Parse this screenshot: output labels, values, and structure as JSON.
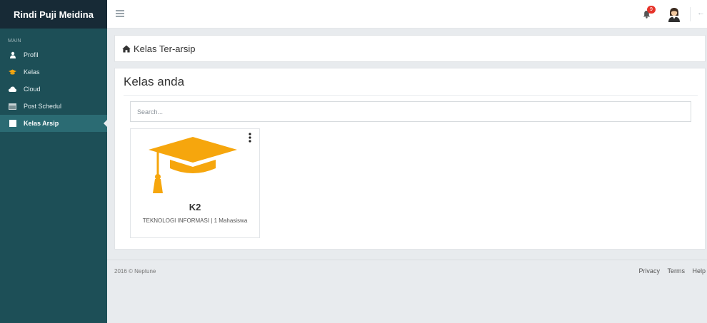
{
  "sidebar": {
    "brand": "Rindi Puji Meidina",
    "section_label": "MAIN",
    "items": [
      {
        "label": "Profil",
        "icon": "user-icon"
      },
      {
        "label": "Kelas",
        "icon": "graduation-cap-icon"
      },
      {
        "label": "Cloud",
        "icon": "cloud-icon"
      },
      {
        "label": "Post Schedul",
        "icon": "calendar-icon"
      },
      {
        "label": "Kelas Arsip",
        "icon": "archive-icon",
        "active": true
      }
    ]
  },
  "topbar": {
    "notification_count": "9"
  },
  "breadcrumb": {
    "title": "Kelas Ter-arsip"
  },
  "main": {
    "title": "Kelas anda",
    "search_placeholder": "Search...",
    "cards": [
      {
        "title": "K2",
        "meta": "TEKNOLOGI INFORMASI | 1 Mahasiswa"
      }
    ]
  },
  "footer": {
    "copyright": "2016 © Neptune",
    "links": [
      "Privacy",
      "Terms",
      "Help"
    ]
  },
  "colors": {
    "sidebar_bg": "#1d4f57",
    "brand_bg": "#172a36",
    "active_item": "#2b6b73",
    "accent_orange": "#f6a60d",
    "badge_red": "#e6332a"
  }
}
